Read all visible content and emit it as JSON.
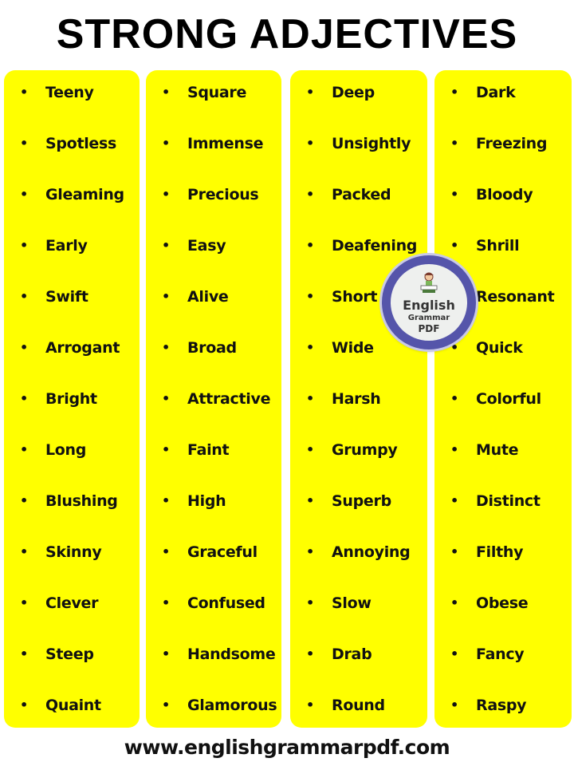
{
  "title": "STRONG ADJECTIVES",
  "columns": [
    {
      "items": [
        "Teeny",
        "Spotless",
        "Gleaming",
        "Early",
        "Swift",
        "Arrogant",
        "Bright",
        "Long",
        "Blushing",
        "Skinny",
        "Clever",
        "Steep",
        "Quaint"
      ]
    },
    {
      "items": [
        "Square",
        "Immense",
        "Precious",
        "Easy",
        "Alive",
        "Broad",
        "Attractive",
        "Faint",
        "High",
        "Graceful",
        "Confused",
        "Handsome",
        "Glamorous"
      ]
    },
    {
      "items": [
        "Deep",
        "Unsightly",
        "Packed",
        "Deafening",
        "Short",
        "Wide",
        "Harsh",
        "Grumpy",
        "Superb",
        "Annoying",
        "Slow",
        "Drab",
        "Round"
      ]
    },
    {
      "items": [
        "Dark",
        "Freezing",
        "Bloody",
        "Shrill",
        "Resonant",
        "Quick",
        "Colorful",
        "Mute",
        "Distinct",
        "Filthy",
        "Obese",
        "Fancy",
        "Raspy"
      ]
    }
  ],
  "bullet": "•",
  "logo": {
    "line1": "English",
    "line2": "Grammar",
    "line3": "PDF",
    "icon": "girl-reading-icon"
  },
  "footer": "www.englishgrammarpdf.com",
  "colors": {
    "card": "#ffff00",
    "text": "#111111",
    "logo_ring": "#5555aa"
  }
}
